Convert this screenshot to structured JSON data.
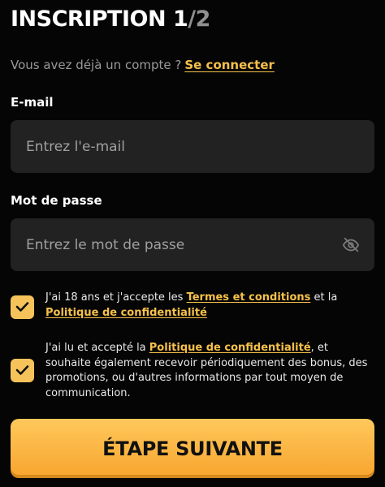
{
  "header": {
    "title_main": "INSCRIPTION 1",
    "title_total": "/2"
  },
  "login": {
    "prompt": "Vous avez déjà un compte ?",
    "link": "Se connecter"
  },
  "email": {
    "label": "E-mail",
    "placeholder": "Entrez l'e-mail",
    "value": ""
  },
  "password": {
    "label": "Mot de passe",
    "placeholder": "Entrez le mot de passe",
    "value": ""
  },
  "consent_terms": {
    "checked": true,
    "text_before": "J'ai 18 ans et j'accepte les ",
    "terms_link": "Termes et conditions",
    "text_middle": " et la ",
    "privacy_link": "Politique de confidentialité"
  },
  "consent_marketing": {
    "checked": true,
    "text_before": "J'ai lu et accepté la ",
    "privacy_link": "Politique de confidentialité",
    "text_after": ", et souhaite également recevoir périodiquement des bonus, des promotions, ou d'autres informations par tout moyen de communication."
  },
  "next_button": {
    "label": "ÉTAPE SUIVANTE"
  },
  "colors": {
    "background": "#050505",
    "accent": "#f6c14a",
    "input_bg": "#222222",
    "button_top": "#ffc85c",
    "button_bottom": "#f7a52d"
  }
}
